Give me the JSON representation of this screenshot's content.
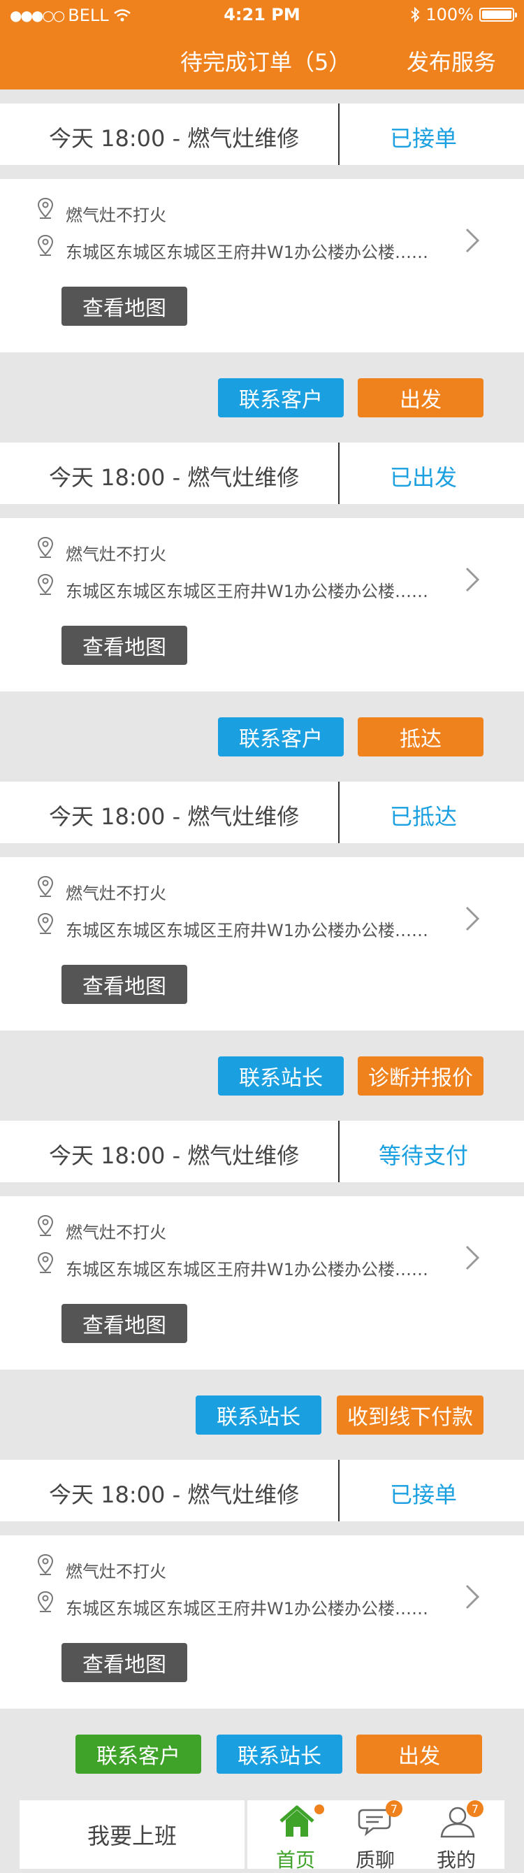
{
  "status_bar": {
    "carrier": "BELL",
    "time": "4:21 PM",
    "battery": "100%"
  },
  "nav": {
    "title": "待完成订单（5）",
    "publish": "发布服务"
  },
  "orders": [
    {
      "info": "今天  18:00  -  燃气灶维修",
      "status": "已接单",
      "issue": "燃气灶不打火",
      "address": "东城区东城区东城区王府井W1办公楼办公楼……",
      "map_button": "查看地图",
      "actions": [
        "联系客户",
        "出发"
      ]
    },
    {
      "info": "今天  18:00  -  燃气灶维修",
      "status": "已出发",
      "issue": "燃气灶不打火",
      "address": "东城区东城区东城区王府井W1办公楼办公楼……",
      "map_button": "查看地图",
      "actions": [
        "联系客户",
        "抵达"
      ]
    },
    {
      "info": "今天  18:00  -  燃气灶维修",
      "status": "已抵达",
      "issue": "燃气灶不打火",
      "address": "东城区东城区东城区王府井W1办公楼办公楼……",
      "map_button": "查看地图",
      "actions": [
        "联系站长",
        "诊断并报价"
      ]
    },
    {
      "info": "今天  18:00  -  燃气灶维修",
      "status": "等待支付",
      "issue": "燃气灶不打火",
      "address": "东城区东城区东城区王府井W1办公楼办公楼……",
      "map_button": "查看地图",
      "actions": [
        "联系站长",
        "收到线下付款"
      ]
    },
    {
      "info": "今天  18:00  -  燃气灶维修",
      "status": "已接单",
      "issue": "燃气灶不打火",
      "address": "东城区东城区东城区王府井W1办公楼办公楼……",
      "map_button": "查看地图",
      "actions": [
        "联系客户",
        "联系站长",
        "出发"
      ]
    }
  ],
  "tabbar": {
    "work": "我要上班",
    "tabs": [
      {
        "label": "首页",
        "icon": "home-icon"
      },
      {
        "label": "质聊",
        "icon": "chat-icon",
        "badge": "7"
      },
      {
        "label": "我的",
        "icon": "user-icon",
        "badge": "7"
      }
    ]
  },
  "colors": {
    "accent": "#f0821e",
    "blue": "#1aa0e0",
    "green": "#3fa32a",
    "map_button": "#555555"
  }
}
